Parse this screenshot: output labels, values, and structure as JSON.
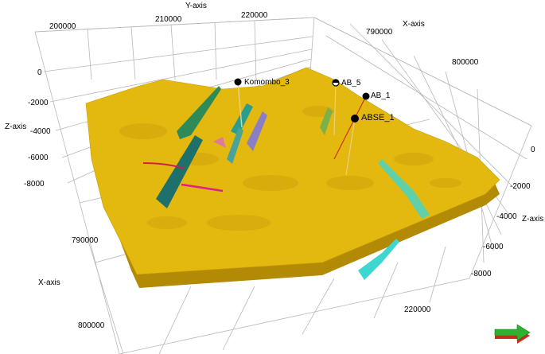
{
  "axes": {
    "y": {
      "title": "Y-axis",
      "ticks": [
        "200000",
        "210000",
        "220000",
        "220000"
      ]
    },
    "x": {
      "title": "X-axis",
      "ticks_top": [
        "790000",
        "800000"
      ],
      "ticks_left": [
        "790000",
        "800000"
      ]
    },
    "z": {
      "title": "Z-axis",
      "ticks_left": [
        "0",
        "-2000",
        "-4000",
        "-6000",
        "-8000"
      ],
      "ticks_right": [
        "0",
        "-2000",
        "-4000",
        "-6000",
        "-8000"
      ]
    }
  },
  "wells": [
    {
      "name": "Komombo_3"
    },
    {
      "name": "AB_5"
    },
    {
      "name": "AB_1"
    },
    {
      "name": "ABSE_1"
    }
  ],
  "colors": {
    "surface": "#e3b80f",
    "surface_dark": "#b38a05",
    "grid": "#b8b8b8",
    "fault_green": "#2e8b57",
    "fault_teal": "#1f6f6a",
    "fault_cyan": "#3dd6d0",
    "fault_purple": "#8a7ec4",
    "horizon_magenta": "#e0208a"
  },
  "icons": {
    "orientation": "orientation-arrow-icon"
  }
}
